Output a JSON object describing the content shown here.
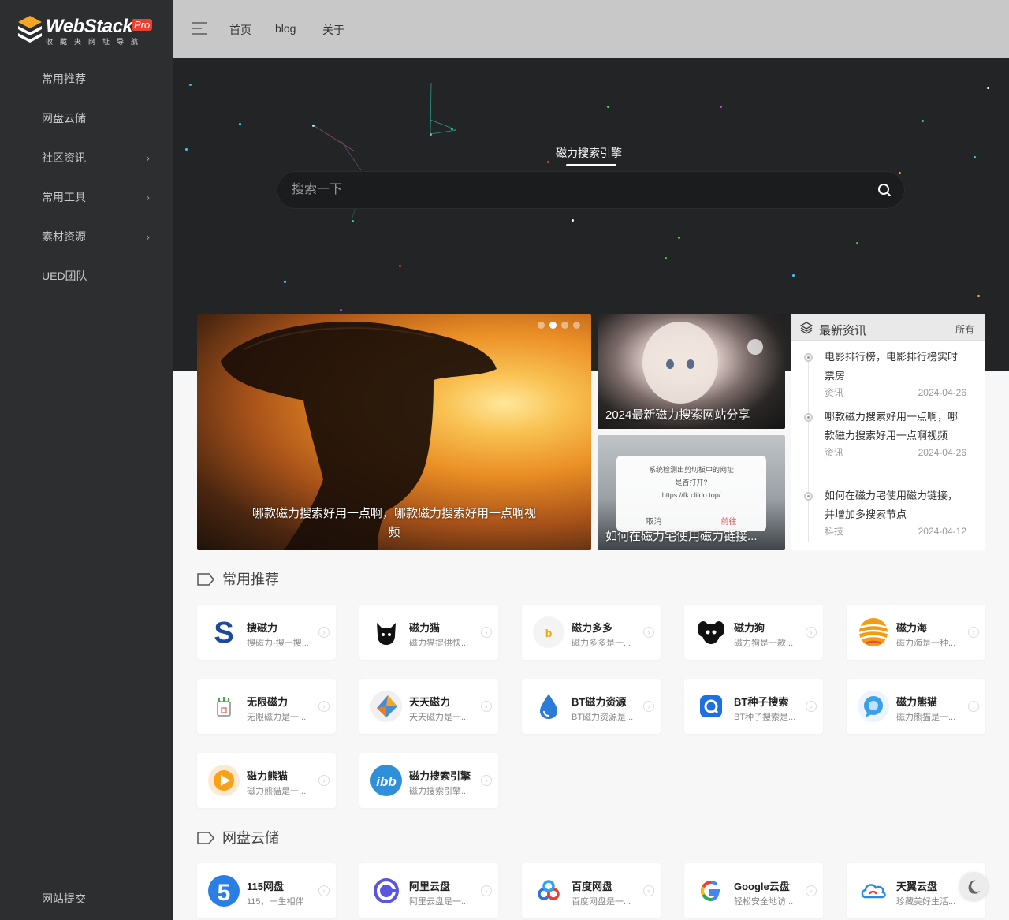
{
  "logo": {
    "text": "WebStack",
    "badge": "Pro",
    "subtitle": "收藏夹网址导航"
  },
  "sidebar": {
    "items": [
      {
        "label": "常用推荐",
        "chevron": ""
      },
      {
        "label": "网盘云储",
        "chevron": ""
      },
      {
        "label": "社区资讯",
        "chevron": "›"
      },
      {
        "label": "常用工具",
        "chevron": "›"
      },
      {
        "label": "素材资源",
        "chevron": "›"
      },
      {
        "label": "UED团队",
        "chevron": ""
      }
    ],
    "bottom": "网站提交"
  },
  "header": {
    "links": [
      "首页",
      "blog",
      "关于"
    ]
  },
  "search": {
    "tab": "磁力搜索引擎",
    "placeholder": "搜索一下"
  },
  "banners": {
    "big": {
      "caption": "哪款磁力搜索好用一点啊，哪款磁力搜索好用一点啊视频"
    },
    "small1": {
      "caption": "2024最新磁力搜索网站分享"
    },
    "small2": {
      "caption": "如何在磁力宅使用磁力链接...",
      "dialog_line1": "系统检测出剪切板中的网址",
      "dialog_line2": "是否打开?",
      "dialog_url": "https://fk.clildo.top/",
      "cancel": "取消",
      "ok": "前往"
    }
  },
  "news": {
    "title": "最新资讯",
    "all": "所有",
    "items": [
      {
        "title": "电影排行榜，电影排行榜实时票房",
        "category": "资讯",
        "date": "2024-04-26"
      },
      {
        "title": "哪款磁力搜索好用一点啊，哪款磁力搜索好用一点啊视频",
        "category": "资讯",
        "date": "2024-04-26"
      },
      {
        "title": "如何在磁力宅使用磁力链接，并增加多搜索节点",
        "category": "科技",
        "date": "2024-04-12"
      }
    ]
  },
  "sections": [
    {
      "title": "常用推荐",
      "cards": [
        {
          "name": "搜磁力",
          "desc": "搜磁力-搜一搜...",
          "icon": "s-logo-icon"
        },
        {
          "name": "磁力猫",
          "desc": "磁力猫提供快...",
          "icon": "cat-icon"
        },
        {
          "name": "磁力多多",
          "desc": "磁力多多是一...",
          "icon": "b-logo-icon"
        },
        {
          "name": "磁力狗",
          "desc": "磁力狗是一款...",
          "icon": "dog-icon"
        },
        {
          "name": "磁力海",
          "desc": "磁力海是一种...",
          "icon": "wave-sphere-icon"
        },
        {
          "name": "无限磁力",
          "desc": "无限磁力是一...",
          "icon": "jar-icon"
        },
        {
          "name": "天天磁力",
          "desc": "天天磁力是一...",
          "icon": "diamond-icon"
        },
        {
          "name": "BT磁力资源",
          "desc": "BT磁力资源是...",
          "icon": "drop-icon"
        },
        {
          "name": "BT种子搜索",
          "desc": "BT种子搜索是...",
          "icon": "blue-square-icon"
        },
        {
          "name": "磁力熊猫",
          "desc": "磁力熊猫是一...",
          "icon": "chat-bubble-icon"
        },
        {
          "name": "磁力熊猫",
          "desc": "磁力熊猫是一...",
          "icon": "play-icon"
        },
        {
          "name": "磁力搜索引擎",
          "desc": "磁力搜索引擎...",
          "icon": "ibb-icon"
        }
      ]
    },
    {
      "title": "网盘云储",
      "cards": [
        {
          "name": "115网盘",
          "desc": "115，一生相伴",
          "icon": "five-icon"
        },
        {
          "name": "阿里云盘",
          "desc": "阿里云盘是一...",
          "icon": "aliyun-icon"
        },
        {
          "name": "百度网盘",
          "desc": "百度网盘是一...",
          "icon": "baidu-icon"
        },
        {
          "name": "Google云盘",
          "desc": "轻松安全地访...",
          "icon": "google-icon"
        },
        {
          "name": "天翼云盘",
          "desc": "珍藏美好生活...",
          "icon": "cloud-icon"
        }
      ]
    }
  ],
  "colors": {
    "sidebar": "#2c2e2f",
    "header": "#c8c8c8",
    "hero": "#232426",
    "accent": "#e8412f"
  }
}
